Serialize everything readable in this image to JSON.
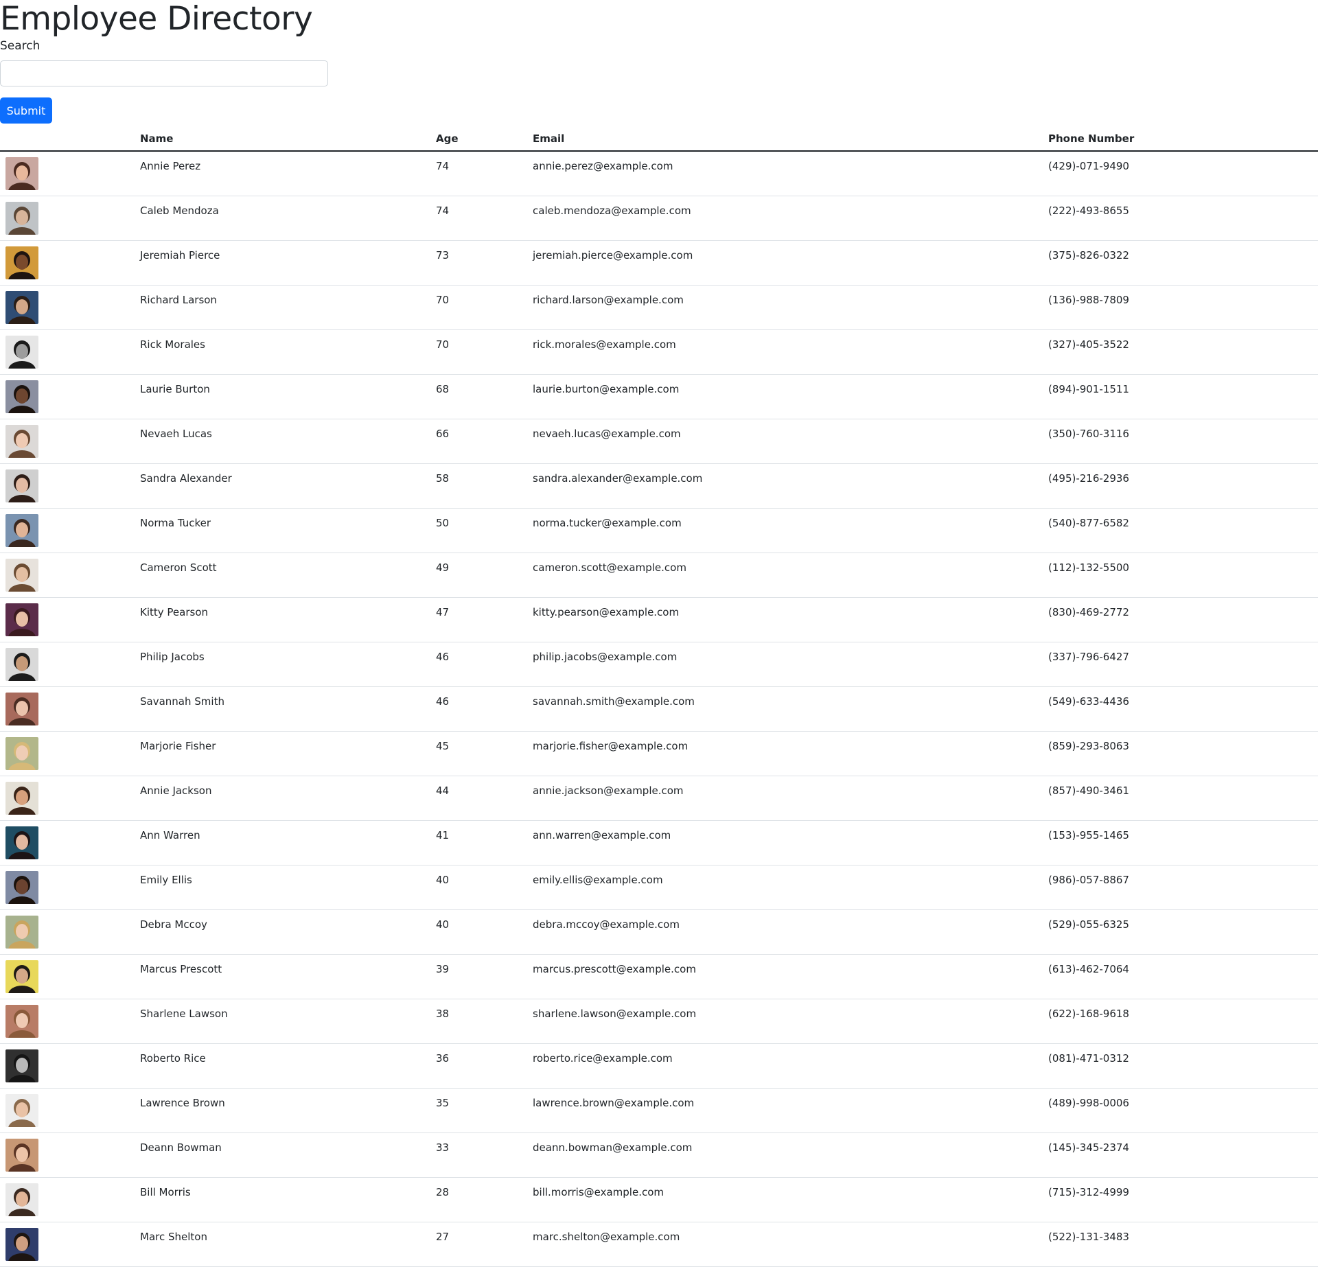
{
  "header": {
    "title": "Employee Directory"
  },
  "search": {
    "label": "Search",
    "value": "",
    "placeholder": "",
    "submit_label": "Submit"
  },
  "table": {
    "columns": [
      "",
      "Name",
      "Age",
      "Email",
      "Phone Number"
    ],
    "rows": [
      {
        "name": "Annie Perez",
        "age": "74",
        "email": "annie.perez@example.com",
        "phone": "(429)-071-9490",
        "bg": "#c9a7a0",
        "skin": "#e8b89c",
        "hair": "#4a2a20"
      },
      {
        "name": "Caleb Mendoza",
        "age": "74",
        "email": "caleb.mendoza@example.com",
        "phone": "(222)-493-8655",
        "bg": "#bfc3c6",
        "skin": "#d7b49a",
        "hair": "#5a4636"
      },
      {
        "name": "Jeremiah Pierce",
        "age": "73",
        "email": "jeremiah.pierce@example.com",
        "phone": "(375)-826-0322",
        "bg": "#d29a3a",
        "skin": "#7a4a2c",
        "hair": "#1e1410"
      },
      {
        "name": "Richard Larson",
        "age": "70",
        "email": "richard.larson@example.com",
        "phone": "(136)-988-7809",
        "bg": "#2f4d74",
        "skin": "#d3a888",
        "hair": "#2b1e16"
      },
      {
        "name": "Rick Morales",
        "age": "70",
        "email": "rick.morales@example.com",
        "phone": "(327)-405-3522",
        "bg": "#e6e6e6",
        "skin": "#9c9c9c",
        "hair": "#1a1a1a"
      },
      {
        "name": "Laurie Burton",
        "age": "68",
        "email": "laurie.burton@example.com",
        "phone": "(894)-901-1511",
        "bg": "#8a8fa0",
        "skin": "#6e4630",
        "hair": "#1a120e"
      },
      {
        "name": "Nevaeh Lucas",
        "age": "66",
        "email": "nevaeh.lucas@example.com",
        "phone": "(350)-760-3116",
        "bg": "#dcd9d7",
        "skin": "#efcab3",
        "hair": "#6a4a34"
      },
      {
        "name": "Sandra Alexander",
        "age": "58",
        "email": "sandra.alexander@example.com",
        "phone": "(495)-216-2936",
        "bg": "#cfcfcf",
        "skin": "#e3bba4",
        "hair": "#2d1d17"
      },
      {
        "name": "Norma Tucker",
        "age": "50",
        "email": "norma.tucker@example.com",
        "phone": "(540)-877-6582",
        "bg": "#7a93b0",
        "skin": "#e0b497",
        "hair": "#3a2820"
      },
      {
        "name": "Cameron Scott",
        "age": "49",
        "email": "cameron.scott@example.com",
        "phone": "(112)-132-5500",
        "bg": "#e7e2dc",
        "skin": "#e4bfa2",
        "hair": "#6b4c33"
      },
      {
        "name": "Kitty Pearson",
        "age": "47",
        "email": "kitty.pearson@example.com",
        "phone": "(830)-469-2772",
        "bg": "#5b2c4a",
        "skin": "#e8bfa6",
        "hair": "#3b1a1f"
      },
      {
        "name": "Philip Jacobs",
        "age": "46",
        "email": "philip.jacobs@example.com",
        "phone": "(337)-796-6427",
        "bg": "#d9d9d9",
        "skin": "#c69a78",
        "hair": "#1c1c1c"
      },
      {
        "name": "Savannah Smith",
        "age": "46",
        "email": "savannah.smith@example.com",
        "phone": "(549)-633-4436",
        "bg": "#a86a5c",
        "skin": "#ebc3ac",
        "hair": "#4a2c22"
      },
      {
        "name": "Marjorie Fisher",
        "age": "45",
        "email": "marjorie.fisher@example.com",
        "phone": "(859)-293-8063",
        "bg": "#b2b78a",
        "skin": "#efcdb5",
        "hair": "#d6b978"
      },
      {
        "name": "Annie Jackson",
        "age": "44",
        "email": "annie.jackson@example.com",
        "phone": "(857)-490-3461",
        "bg": "#e4e0d6",
        "skin": "#d7a07c",
        "hair": "#3a2418"
      },
      {
        "name": "Ann Warren",
        "age": "41",
        "email": "ann.warren@example.com",
        "phone": "(153)-955-1465",
        "bg": "#1f4d63",
        "skin": "#e2b8a0",
        "hair": "#1c1416"
      },
      {
        "name": "Emily Ellis",
        "age": "40",
        "email": "emily.ellis@example.com",
        "phone": "(986)-057-8867",
        "bg": "#7f8aa3",
        "skin": "#6b4330",
        "hair": "#1b120d"
      },
      {
        "name": "Debra Mccoy",
        "age": "40",
        "email": "debra.mccoy@example.com",
        "phone": "(529)-055-6325",
        "bg": "#a7b28e",
        "skin": "#efcbb0",
        "hair": "#c9a55e"
      },
      {
        "name": "Marcus Prescott",
        "age": "39",
        "email": "marcus.prescott@example.com",
        "phone": "(613)-462-7064",
        "bg": "#e8d85a",
        "skin": "#d4a888",
        "hair": "#1e1a16"
      },
      {
        "name": "Sharlene Lawson",
        "age": "38",
        "email": "sharlene.lawson@example.com",
        "phone": "(622)-168-9618",
        "bg": "#b87c66",
        "skin": "#efcab3",
        "hair": "#8a5a3a"
      },
      {
        "name": "Roberto Rice",
        "age": "36",
        "email": "roberto.rice@example.com",
        "phone": "(081)-471-0312",
        "bg": "#303030",
        "skin": "#b8b8b8",
        "hair": "#151515"
      },
      {
        "name": "Lawrence Brown",
        "age": "35",
        "email": "lawrence.brown@example.com",
        "phone": "(489)-998-0006",
        "bg": "#eeeeee",
        "skin": "#e9c2a6",
        "hair": "#8a6a4c"
      },
      {
        "name": "Deann Bowman",
        "age": "33",
        "email": "deann.bowman@example.com",
        "phone": "(145)-345-2374",
        "bg": "#c79774",
        "skin": "#edc4a8",
        "hair": "#5a3424"
      },
      {
        "name": "Bill Morris",
        "age": "28",
        "email": "bill.morris@example.com",
        "phone": "(715)-312-4999",
        "bg": "#e9e9e9",
        "skin": "#e2b698",
        "hair": "#3b2a20"
      },
      {
        "name": "Marc Shelton",
        "age": "27",
        "email": "marc.shelton@example.com",
        "phone": "(522)-131-3483",
        "bg": "#2f3d6b",
        "skin": "#cf9f80",
        "hair": "#1d1511"
      }
    ]
  }
}
